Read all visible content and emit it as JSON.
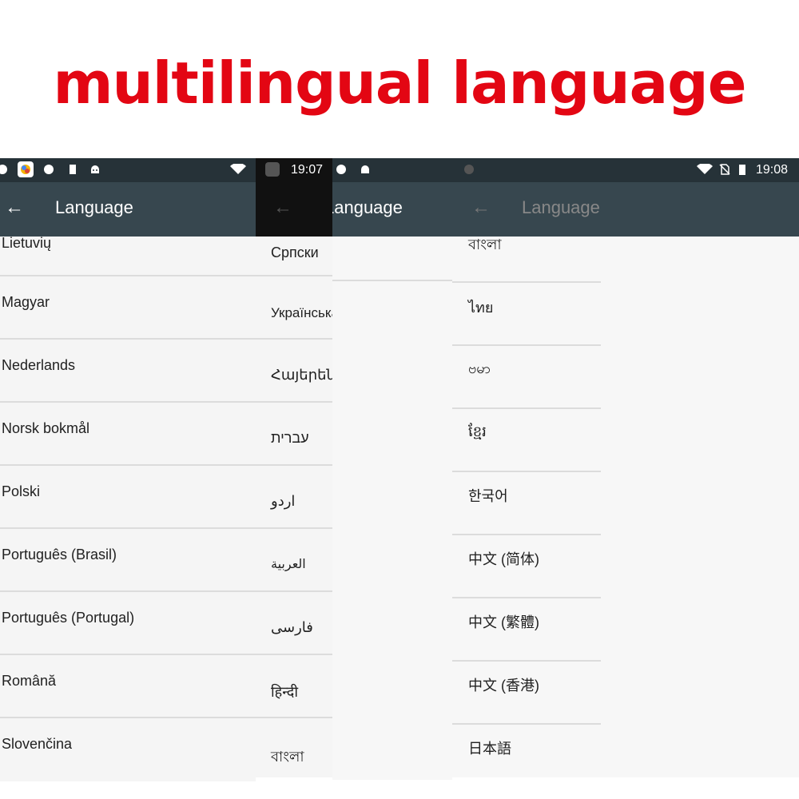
{
  "headline": "multilingual language",
  "screens": [
    {
      "time": "",
      "title": "Language",
      "items": [
        "Lietuvių",
        "Magyar",
        "Nederlands",
        "Norsk bokmål",
        "Polski",
        "Português (Brasil)",
        "Português (Portugal)",
        "Română",
        "Slovenčina"
      ]
    },
    {
      "time": "19:07",
      "title": "Language",
      "items": [
        "Српски",
        "Українська",
        "Հայերեն",
        "עברית",
        "اردو",
        "العربية",
        "فارسی",
        "हिन्दी",
        "বাংলা"
      ]
    },
    {
      "time": "19:08",
      "title": "Language",
      "items": [
        "বাংলা",
        "ไทย",
        "ဗမာ",
        "ខ្មែរ",
        "한국어",
        "中文 (简体)",
        "中文 (繁體)",
        "中文 (香港)",
        "日本語"
      ]
    }
  ],
  "colors": {
    "headline": "#e30613",
    "statusbar": "#263238",
    "appbar": "#37474f",
    "list_bg": "#f5f5f5"
  },
  "icons": [
    "back-arrow-icon",
    "wifi-icon",
    "battery-icon",
    "android-icon",
    "shield-icon",
    "sd-card-icon",
    "no-sim-icon"
  ]
}
